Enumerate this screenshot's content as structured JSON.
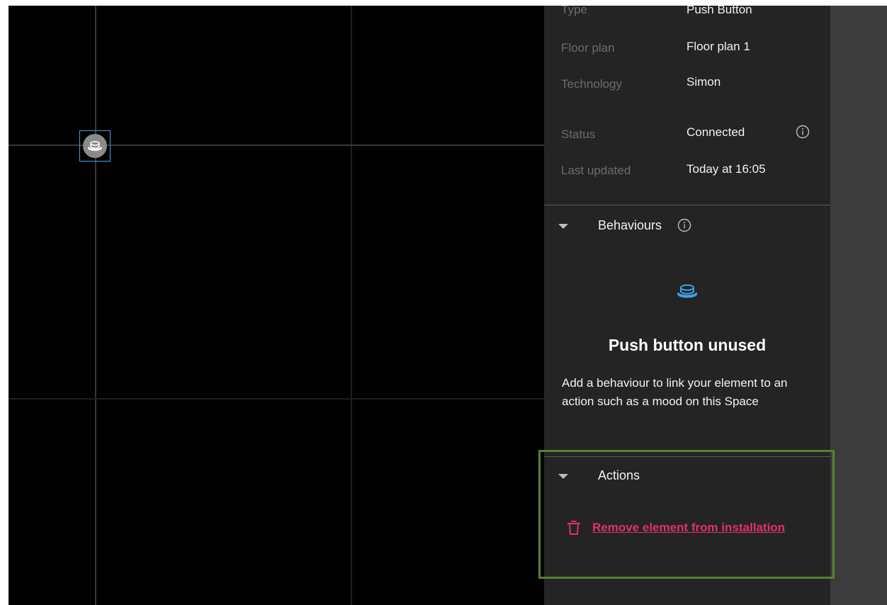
{
  "properties": [
    {
      "label": "Type",
      "value": "Push Button"
    },
    {
      "label": "Floor plan",
      "value": "Floor plan 1"
    },
    {
      "label": "Technology",
      "value": "Simon"
    },
    {
      "label": "Status",
      "value": "Connected"
    },
    {
      "label": "Last updated",
      "value": "Today at 16:05"
    }
  ],
  "behaviours": {
    "title": "Behaviours",
    "empty_title": "Push button unused",
    "empty_description": "Add a behaviour to link your element to an action such as a mood on this Space",
    "icon": "push-button-icon"
  },
  "actions": {
    "title": "Actions",
    "remove_label": "Remove element from installation",
    "remove_icon": "trash-icon"
  },
  "colors": {
    "accent": "#3ea3e8",
    "danger": "#e0306e",
    "highlight": "#55822c",
    "panel": "#242424",
    "canvas": "#000000"
  }
}
